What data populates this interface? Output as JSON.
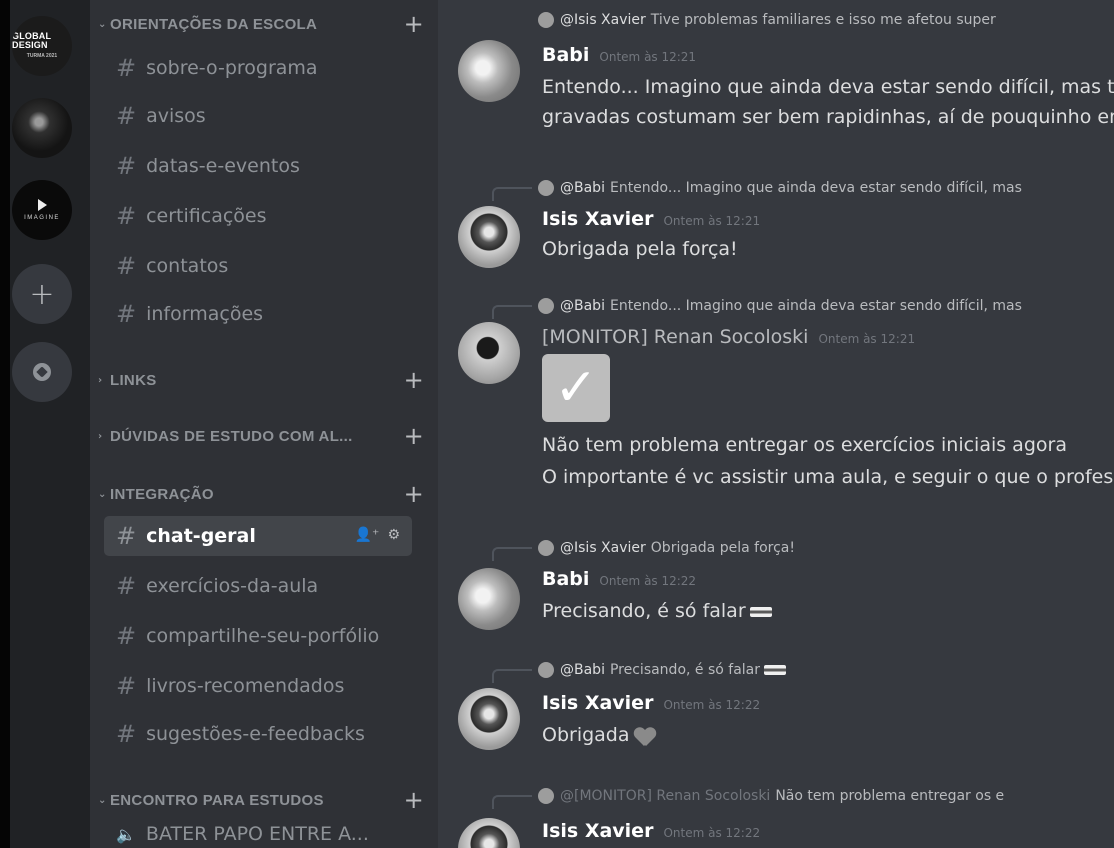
{
  "servers": [
    {
      "name": "GLOBAL DESIGN",
      "sub": "TURMA 2021"
    },
    {
      "name": ""
    },
    {
      "name": "IMAGINE"
    }
  ],
  "sidebar": {
    "categories": [
      {
        "label": "ORIENTAÇÕES DA ESCOLA",
        "channels": [
          "sobre-o-programa",
          "avisos",
          "datas-e-eventos",
          "certificações",
          "contatos",
          "informações"
        ]
      },
      {
        "label": "LINKS",
        "channels": []
      },
      {
        "label": "DÚVIDAS DE ESTUDO COM AL...",
        "channels": []
      },
      {
        "label": "INTEGRAÇÃO",
        "channels": [
          "chat-geral",
          "exercícios-da-aula",
          "compartilhe-seu-porfólio",
          "livros-recomendados",
          "sugestões-e-feedbacks"
        ]
      },
      {
        "label": "ENCONTRO PARA ESTUDOS",
        "channels": []
      }
    ],
    "active_channel": "chat-geral",
    "voice_channel": "BATER PAPO ENTRE A..."
  },
  "messages": [
    {
      "reply_to": "@Isis Xavier",
      "reply_text": "Tive problemas familiares e isso me afetou super"
    },
    {
      "author": "Babi",
      "time": "Ontem às 12:21",
      "lines": [
        "Entendo... Imagino que ainda deva estar sendo difícil, mas te",
        "gravadas costumam ser bem rapidinhas, aí de pouquinho em"
      ]
    },
    {
      "reply_to": "@Babi",
      "reply_text": "Entendo... Imagino que ainda deva estar sendo difícil, mas",
      "author": "Isis Xavier",
      "time": "Ontem às 12:21",
      "lines": [
        "Obrigada pela força!"
      ]
    },
    {
      "reply_to": "@Babi",
      "reply_text": "Entendo... Imagino que ainda deva estar sendo difícil, mas",
      "author": "[MONITOR] Renan Socoloski",
      "time": "Ontem às 12:21",
      "lines": [
        "Não tem problema entregar os exercícios iniciais agora",
        "O importante é vc assistir uma aula, e seguir o que o profess"
      ]
    },
    {
      "reply_to": "@Isis Xavier",
      "reply_text": "Obrigada pela força!",
      "author": "Babi",
      "time": "Ontem às 12:22",
      "lines": [
        "Precisando, é só falar"
      ]
    },
    {
      "reply_to": "@Babi",
      "reply_text": "Precisando, é só falar",
      "author": "Isis Xavier",
      "time": "Ontem às 12:22",
      "lines": [
        "Obrigada"
      ]
    },
    {
      "reply_to": "@[MONITOR] Renan Socoloski",
      "reply_text": "Não tem problema entregar os e",
      "author": "Isis Xavier",
      "time": "Ontem às 12:22",
      "lines": []
    }
  ],
  "icons": [
    "add-server-icon",
    "explore-icon",
    "hash-icon",
    "add-member-icon",
    "gear-icon",
    "speaker-icon",
    "check-emoji",
    "flag-emoji",
    "heart-emoji"
  ]
}
